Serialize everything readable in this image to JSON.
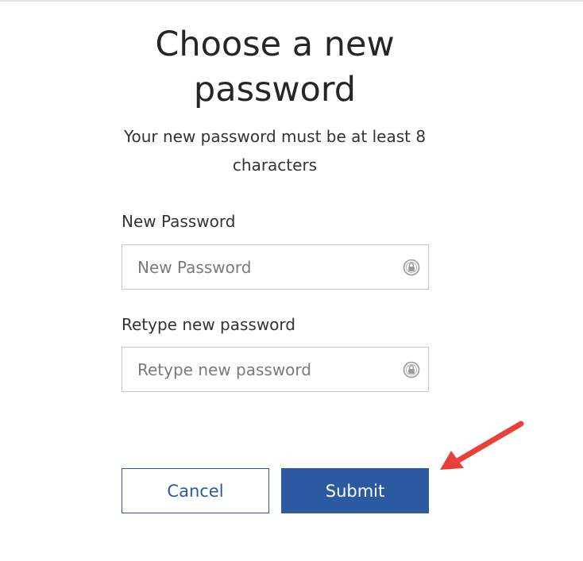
{
  "page": {
    "title": "Choose a new password",
    "subtitle": "Your new password must be at least 8 characters"
  },
  "form": {
    "new_password": {
      "label": "New Password",
      "placeholder": "New Password",
      "value": ""
    },
    "retype_password": {
      "label": "Retype new password",
      "placeholder": "Retype new password",
      "value": ""
    }
  },
  "actions": {
    "cancel_label": "Cancel",
    "submit_label": "Submit"
  },
  "icons": {
    "password_manager": "password-key-icon",
    "annotation": "red-arrow-icon"
  },
  "colors": {
    "primary": "#2b5aa0",
    "annotation": "#e8413c",
    "border": "#c8c8c8",
    "text": "#262626"
  }
}
